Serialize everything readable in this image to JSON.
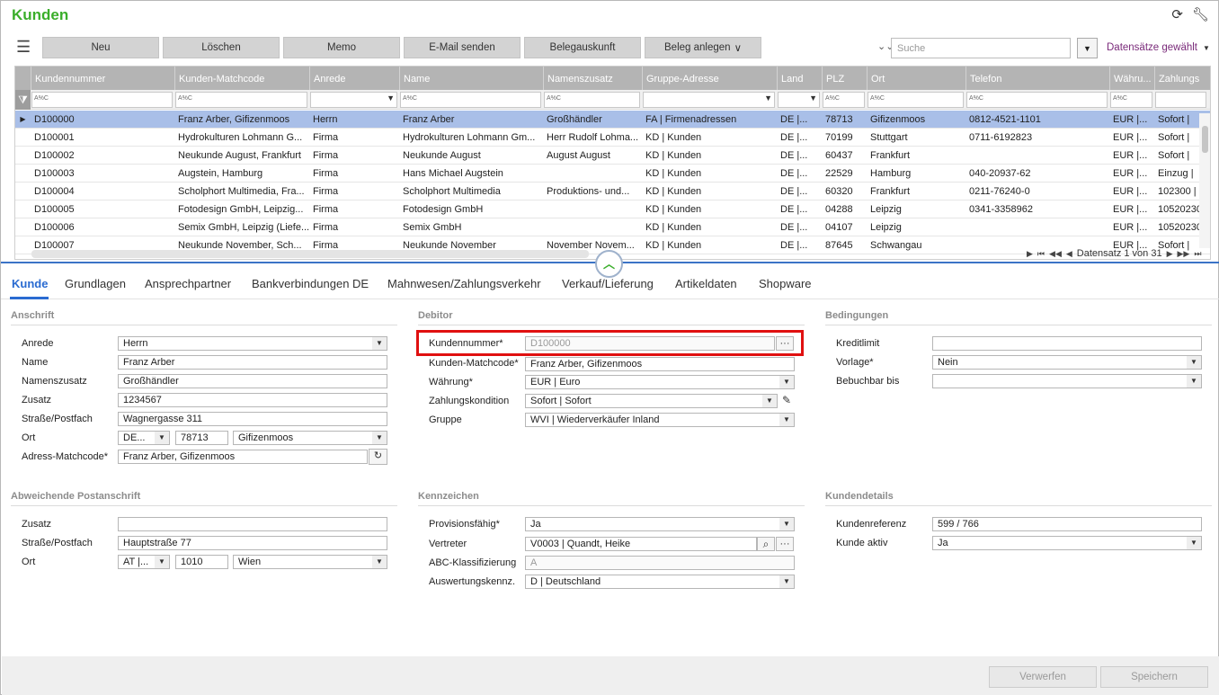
{
  "app": {
    "title": "Kunden",
    "refresh_icon": "refresh-icon",
    "settings_icon": "wrench-icon"
  },
  "toolbar": {
    "buttons": [
      "Neu",
      "Löschen",
      "Memo",
      "E-Mail senden",
      "Belegauskunft",
      "Beleg anlegen"
    ],
    "beleg_arrow": "∨",
    "search_placeholder": "Suche",
    "records_selected": "Datensätze gewählt"
  },
  "grid": {
    "columns": [
      "Kundennummer",
      "Kunden-Matchcode",
      "Anrede",
      "Name",
      "Namenszusatz",
      "Gruppe-Adresse",
      "Land",
      "PLZ",
      "Ort",
      "Telefon",
      "Währu...",
      "Zahlungs"
    ],
    "filter_token": "A%C",
    "rows": [
      [
        "D100000",
        "Franz Arber, Gifizenmoos",
        "Herrn",
        "Franz Arber",
        "Großhändler",
        "FA | Firmenadressen",
        "DE |...",
        "78713",
        "Gifizenmoos",
        "0812-4521-1101",
        "EUR |...",
        "Sofort |"
      ],
      [
        "D100001",
        "Hydrokulturen Lohmann G...",
        "Firma",
        "Hydrokulturen Lohmann Gm...",
        "Herr Rudolf Lohma...",
        "KD | Kunden",
        "DE |...",
        "70199",
        "Stuttgart",
        "0711-6192823",
        "EUR |...",
        "Sofort |"
      ],
      [
        "D100002",
        "Neukunde August, Frankfurt",
        "Firma",
        "Neukunde August",
        "August August",
        "KD | Kunden",
        "DE |...",
        "60437",
        "Frankfurt",
        "",
        "EUR |...",
        "Sofort |"
      ],
      [
        "D100003",
        "Augstein, Hamburg",
        "Firma",
        "Hans Michael Augstein",
        "",
        "KD | Kunden",
        "DE |...",
        "22529",
        "Hamburg",
        "040-20937-62",
        "EUR |...",
        "Einzug |"
      ],
      [
        "D100004",
        "Scholphort Multimedia, Fra...",
        "Firma",
        "Scholphort Multimedia",
        "Produktions- und...",
        "KD | Kunden",
        "DE |...",
        "60320",
        "Frankfurt",
        "0211-76240-0",
        "EUR |...",
        "102300 |"
      ],
      [
        "D100005",
        "Fotodesign GmbH, Leipzig...",
        "Firma",
        "Fotodesign GmbH",
        "",
        "KD | Kunden",
        "DE |...",
        "04288",
        "Leipzig",
        "0341-3358962",
        "EUR |...",
        "10520230"
      ],
      [
        "D100006",
        "Semix GmbH, Leipzig (Liefe...",
        "Firma",
        "Semix GmbH",
        "",
        "KD | Kunden",
        "DE |...",
        "04107",
        "Leipzig",
        "",
        "EUR |...",
        "10520230"
      ],
      [
        "D100007",
        "Neukunde November, Sch...",
        "Firma",
        "Neukunde November",
        "November Novem...",
        "KD | Kunden",
        "DE |...",
        "87645",
        "Schwangau",
        "",
        "EUR |...",
        "Sofort |"
      ]
    ],
    "pager": "Datensatz 1 von 31"
  },
  "tabs": [
    "Kunde",
    "Grundlagen",
    "Ansprechpartner",
    "Bankverbindungen DE",
    "Mahnwesen/Zahlungsverkehr",
    "Verkauf/Lieferung",
    "Artikeldaten",
    "Shopware"
  ],
  "anschrift": {
    "title": "Anschrift",
    "anrede_label": "Anrede",
    "anrede": "Herrn",
    "name_label": "Name",
    "name": "Franz Arber",
    "namenszusatz_label": "Namenszusatz",
    "namenszusatz": "Großhändler",
    "zusatz_label": "Zusatz",
    "zusatz": "1234567",
    "strasse_label": "Straße/Postfach",
    "strasse": "Wagnergasse 311",
    "ort_label": "Ort",
    "land": "DE...",
    "plz": "78713",
    "ort": "Gifizenmoos",
    "adress_mc_label": "Adress-Matchcode*",
    "adress_mc": "Franz Arber, Gifizenmoos"
  },
  "debitor": {
    "title": "Debitor",
    "kundennummer_label": "Kundennummer*",
    "kundennummer": "D100000",
    "matchcode_label": "Kunden-Matchcode*",
    "matchcode": "Franz Arber, Gifizenmoos",
    "waehrung_label": "Währung*",
    "waehrung": "EUR | Euro",
    "zahlungskondition_label": "Zahlungskondition",
    "zahlungskondition": "Sofort | Sofort",
    "gruppe_label": "Gruppe",
    "gruppe": "WVI | Wiederverkäufer Inland"
  },
  "bedingungen": {
    "title": "Bedingungen",
    "kreditlimit_label": "Kreditlimit",
    "kreditlimit": "",
    "vorlage_label": "Vorlage*",
    "vorlage": "Nein",
    "bebuchbar_label": "Bebuchbar bis",
    "bebuchbar": ""
  },
  "postanschrift": {
    "title": "Abweichende Postanschrift",
    "zusatz_label": "Zusatz",
    "zusatz": "",
    "strasse_label": "Straße/Postfach",
    "strasse": "Hauptstraße 77",
    "ort_label": "Ort",
    "land": "AT |...",
    "plz": "1010",
    "ort": "Wien"
  },
  "kennzeichen": {
    "title": "Kennzeichen",
    "provision_label": "Provisionsfähig*",
    "provision": "Ja",
    "vertreter_label": "Vertreter",
    "vertreter": "V0003 | Quandt, Heike",
    "abc_label": "ABC-Klassifizierung",
    "abc": "A",
    "auswertung_label": "Auswertungskennz.",
    "auswertung": "D | Deutschland"
  },
  "kundendetails": {
    "title": "Kundendetails",
    "referenz_label": "Kundenreferenz",
    "referenz": "599 / 766",
    "aktiv_label": "Kunde aktiv",
    "aktiv": "Ja"
  },
  "footer": {
    "verwerfen": "Verwerfen",
    "speichern": "Speichern"
  }
}
